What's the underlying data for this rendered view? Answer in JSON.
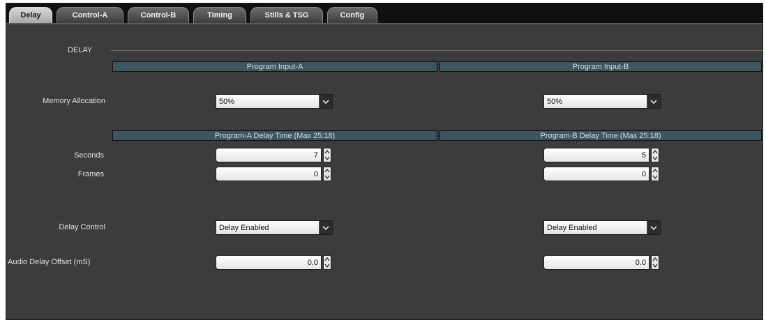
{
  "tabs": [
    {
      "label": "Delay",
      "active": true
    },
    {
      "label": "Control-A",
      "active": false
    },
    {
      "label": "Control-B",
      "active": false
    },
    {
      "label": "Timing",
      "active": false
    },
    {
      "label": "Stills & TSG",
      "active": false
    },
    {
      "label": "Config",
      "active": false
    }
  ],
  "section": {
    "title": "DELAY"
  },
  "headers": {
    "input_a": "Program Input-A",
    "input_b": "Program Input-B",
    "delay_a": "Program-A Delay Time (Max  25:18)",
    "delay_b": "Program-B Delay Time (Max  25:18)"
  },
  "labels": {
    "memory_allocation": "Memory Allocation",
    "seconds": "Seconds",
    "frames": "Frames",
    "delay_control": "Delay Control",
    "audio_delay_offset": "Audio Delay Offset (mS)"
  },
  "program_a": {
    "memory_allocation": "50%",
    "seconds": "7",
    "frames": "0",
    "delay_control": "Delay Enabled",
    "audio_delay_offset": "0.0"
  },
  "program_b": {
    "memory_allocation": "50%",
    "seconds": "5",
    "frames": "0",
    "delay_control": "Delay Enabled",
    "audio_delay_offset": "0.0"
  },
  "colors": {
    "panel_bg": "#3c3c3c",
    "header_bg": "#3e5560",
    "active_tab": "#c8c8c8"
  }
}
